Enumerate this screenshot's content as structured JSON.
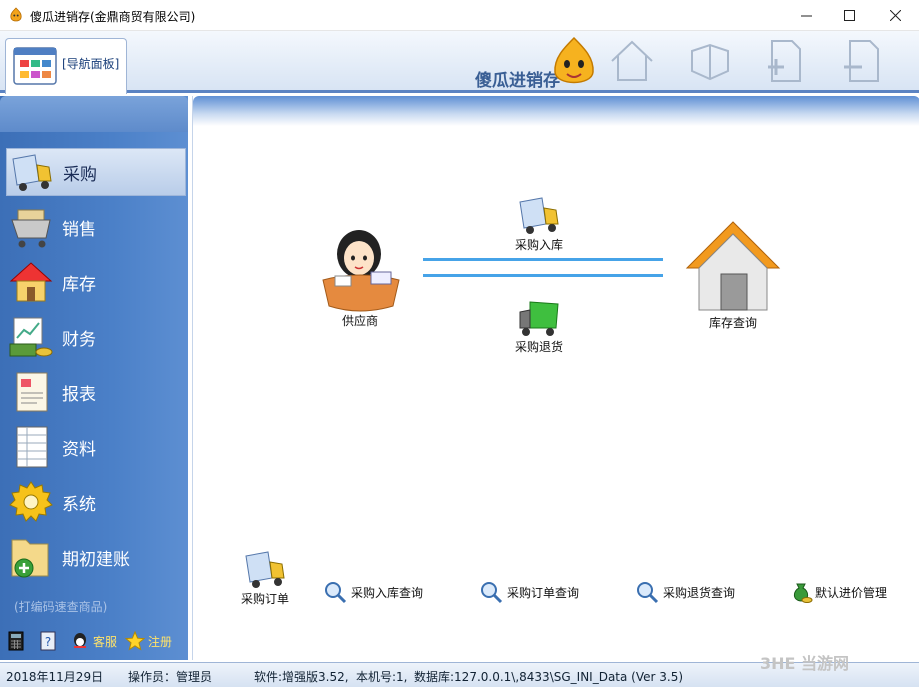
{
  "window": {
    "title": "傻瓜进销存(金鼎商贸有限公司)",
    "minimize_icon": "minimize-icon",
    "maximize_icon": "maximize-icon",
    "close_icon": "close-icon"
  },
  "toolbar": {
    "nav_tab_label": "[导航面板]",
    "brand_text": "傻瓜进销存",
    "icons": [
      "home-icon",
      "cube-icon",
      "add-page-icon",
      "remove-page-icon"
    ]
  },
  "sidebar": {
    "items": [
      {
        "label": "采购",
        "icon": "truck-icon",
        "active": true
      },
      {
        "label": "销售",
        "icon": "cart-icon",
        "active": false
      },
      {
        "label": "库存",
        "icon": "house-icon",
        "active": false
      },
      {
        "label": "财务",
        "icon": "money-icon",
        "active": false
      },
      {
        "label": "报表",
        "icon": "report-icon",
        "active": false
      },
      {
        "label": "资料",
        "icon": "document-icon",
        "active": false
      },
      {
        "label": "系统",
        "icon": "gear-icon",
        "active": false
      },
      {
        "label": "期初建账",
        "icon": "folder-add-icon",
        "active": false
      }
    ],
    "scan_hint": "(打编码速查商品)",
    "footer": {
      "calculator_icon": "calculator-icon",
      "help_icon": "help-icon",
      "service_label": "客服",
      "register_label": "注册"
    }
  },
  "flow": {
    "supplier": "供应商",
    "purchase_in": "采购入库",
    "purchase_return": "采购退货",
    "stock_query": "库存查询"
  },
  "bottom_actions": {
    "purchase_order": "采购订单",
    "in_query": "采购入库查询",
    "order_query": "采购订单查询",
    "return_query": "采购退货查询",
    "default_price": "默认进价管理"
  },
  "status": {
    "date": "2018年11月29日",
    "operator": "操作员：管理员",
    "software": "软件:增强版3.52,",
    "machine": "本机号:1,",
    "database": "数据库:127.0.0.1\\,8433\\SG_INI_Data (Ver 3.5)"
  },
  "watermark": "3HE 当游网",
  "colors": {
    "sidebar": "#4b80c8",
    "accent": "#46a3e8",
    "footer_text": "#ffe36b"
  }
}
